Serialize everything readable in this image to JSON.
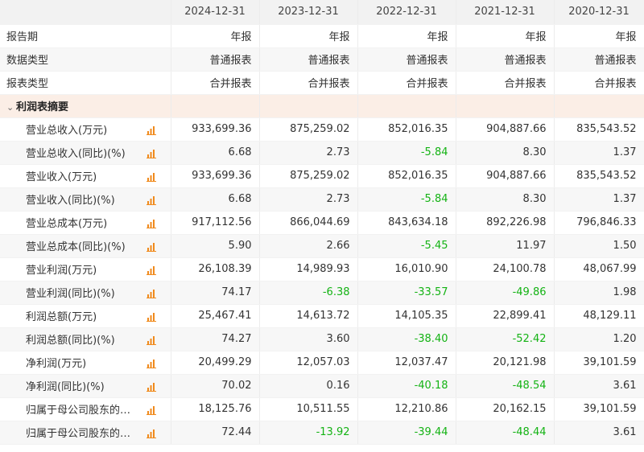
{
  "header": {
    "periods": [
      "2024-12-31",
      "2023-12-31",
      "2022-12-31",
      "2021-12-31",
      "2020-12-31"
    ]
  },
  "meta_rows": [
    {
      "label": "报告期",
      "values": [
        "年报",
        "年报",
        "年报",
        "年报",
        "年报"
      ]
    },
    {
      "label": "数据类型",
      "values": [
        "普通报表",
        "普通报表",
        "普通报表",
        "普通报表",
        "普通报表"
      ]
    },
    {
      "label": "报表类型",
      "values": [
        "合并报表",
        "合并报表",
        "合并报表",
        "合并报表",
        "合并报表"
      ]
    }
  ],
  "section": {
    "label": "利润表摘要",
    "chevron_icon": "chevron-down-icon"
  },
  "metrics": [
    {
      "label": "营业总收入(万元)",
      "values": [
        "933,699.36",
        "875,259.02",
        "852,016.35",
        "904,887.66",
        "835,543.52"
      ]
    },
    {
      "label": "营业总收入(同比)(%)",
      "values": [
        "6.68",
        "2.73",
        "-5.84",
        "8.30",
        "1.37"
      ]
    },
    {
      "label": "营业收入(万元)",
      "values": [
        "933,699.36",
        "875,259.02",
        "852,016.35",
        "904,887.66",
        "835,543.52"
      ]
    },
    {
      "label": "营业收入(同比)(%)",
      "values": [
        "6.68",
        "2.73",
        "-5.84",
        "8.30",
        "1.37"
      ]
    },
    {
      "label": "营业总成本(万元)",
      "values": [
        "917,112.56",
        "866,044.69",
        "843,634.18",
        "892,226.98",
        "796,846.33"
      ]
    },
    {
      "label": "营业总成本(同比)(%)",
      "values": [
        "5.90",
        "2.66",
        "-5.45",
        "11.97",
        "1.50"
      ]
    },
    {
      "label": "营业利润(万元)",
      "values": [
        "26,108.39",
        "14,989.93",
        "16,010.90",
        "24,100.78",
        "48,067.99"
      ]
    },
    {
      "label": "营业利润(同比)(%)",
      "values": [
        "74.17",
        "-6.38",
        "-33.57",
        "-49.86",
        "1.98"
      ]
    },
    {
      "label": "利润总额(万元)",
      "values": [
        "25,467.41",
        "14,613.72",
        "14,105.35",
        "22,899.41",
        "48,129.11"
      ]
    },
    {
      "label": "利润总额(同比)(%)",
      "values": [
        "74.27",
        "3.60",
        "-38.40",
        "-52.42",
        "1.20"
      ]
    },
    {
      "label": "净利润(万元)",
      "values": [
        "20,499.29",
        "12,057.03",
        "12,037.47",
        "20,121.98",
        "39,101.59"
      ]
    },
    {
      "label": "净利润(同比)(%)",
      "values": [
        "70.02",
        "0.16",
        "-40.18",
        "-48.54",
        "3.61"
      ]
    },
    {
      "label": "归属于母公司股东的…",
      "values": [
        "18,125.76",
        "10,511.55",
        "12,210.86",
        "20,162.15",
        "39,101.59"
      ]
    },
    {
      "label": "归属于母公司股东的…",
      "values": [
        "72.44",
        "-13.92",
        "-39.44",
        "-48.44",
        "3.61"
      ]
    }
  ],
  "colors": {
    "negative": "#14b314",
    "chart_icon": "#f08a1c",
    "section_bg": "#fbeee6",
    "header_bg": "#f2f2f2"
  },
  "icons": {
    "metric_chart": "bar-chart-icon"
  }
}
